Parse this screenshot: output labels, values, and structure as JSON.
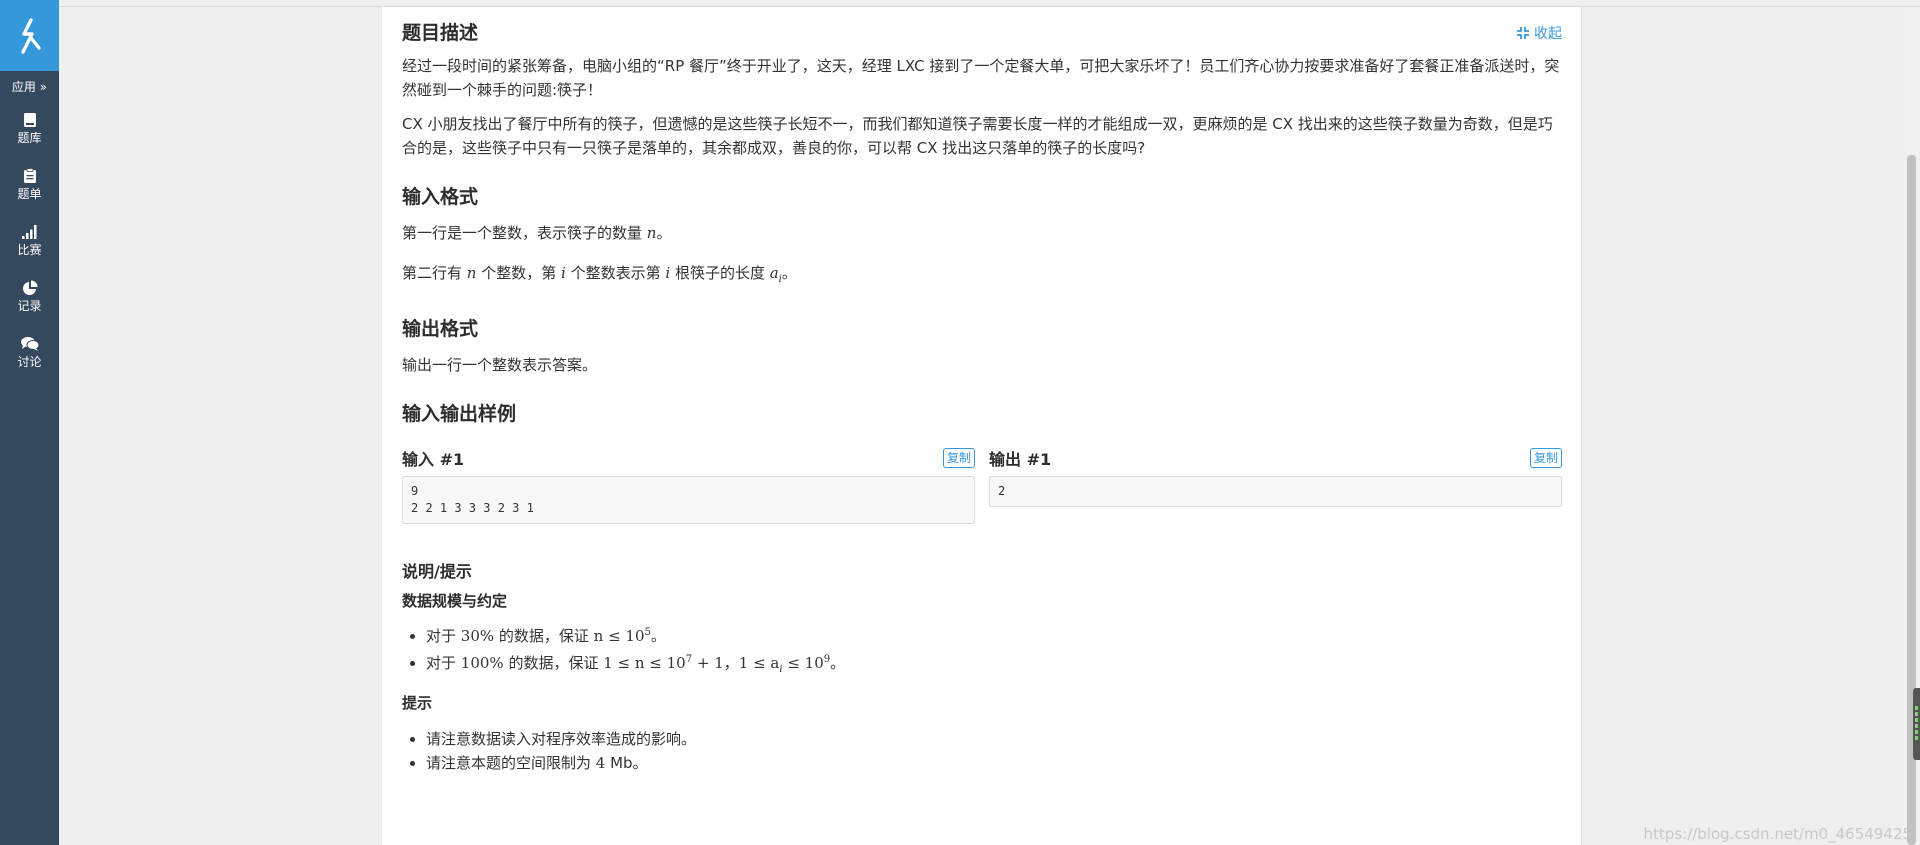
{
  "sidebar": {
    "apps_label": "应用 »",
    "items": [
      {
        "label": "题库",
        "icon": "book-icon"
      },
      {
        "label": "题单",
        "icon": "clipboard-icon"
      },
      {
        "label": "比赛",
        "icon": "signal-bars-icon"
      },
      {
        "label": "记录",
        "icon": "pie-chart-icon"
      },
      {
        "label": "讨论",
        "icon": "comments-icon"
      }
    ]
  },
  "problem": {
    "desc_title": "题目描述",
    "collapse_label": "收起",
    "desc_p1": "经过一段时间的紧张筹备，电脑小组的“RP 餐厅”终于开业了，这天，经理 LXC 接到了一个定餐大单，可把大家乐坏了！员工们齐心协力按要求准备好了套餐正准备派送时，突然碰到一个棘手的问题:筷子！",
    "desc_p2": "CX 小朋友找出了餐厅中所有的筷子，但遗憾的是这些筷子长短不一，而我们都知道筷子需要长度一样的才能组成一双，更麻烦的是 CX 找出来的这些筷子数量为奇数，但是巧合的是，这些筷子中只有一只筷子是落单的，其余都成双，善良的你，可以帮 CX 找出这只落单的筷子的长度吗?",
    "input_title": "输入格式",
    "input_l1_a": "第一行是一个整数，表示筷子的数量 ",
    "input_l1_var": "n",
    "input_l1_b": "。",
    "input_l2_a": "第二行有 ",
    "input_l2_var1": "n",
    "input_l2_b": " 个整数，第 ",
    "input_l2_var2": "i",
    "input_l2_c": " 个整数表示第 ",
    "input_l2_var3": "i",
    "input_l2_d": " 根筷子的长度 ",
    "input_l2_var4": "a",
    "input_l2_sub": "i",
    "input_l2_e": "。",
    "output_title": "输出格式",
    "output_text": "输出一行一个整数表示答案。",
    "samples_title": "输入输出样例",
    "sample_in_label": "输入 #1",
    "sample_out_label": "输出 #1",
    "copy_label": "复制",
    "sample_in": "9\n2 2 1 3 3 3 2 3 1",
    "sample_out": "2",
    "hint_title": "说明/提示",
    "scale_title": "数据规模与约定",
    "scale_1_a": "对于 ",
    "scale_1_pct": "30%",
    "scale_1_b": " 的数据，保证 ",
    "scale_1_expr": "n ≤ 10",
    "scale_1_exp": "5",
    "scale_1_c": "。",
    "scale_2_a": "对于 ",
    "scale_2_pct": "100%",
    "scale_2_b": " 的数据，保证 ",
    "scale_2_expr1": "1 ≤ n ≤ 10",
    "scale_2_exp1": "7",
    "scale_2_expr2": " + 1",
    "scale_2_c": "，",
    "scale_2_expr3": "1 ≤ a",
    "scale_2_sub": "i",
    "scale_2_expr4": " ≤ 10",
    "scale_2_exp2": "9",
    "scale_2_d": "。",
    "tip_title": "提示",
    "tip_1": "请注意数据读入对程序效率造成的影响。",
    "tip_2_a": "请注意本题的空间限制为 ",
    "tip_2_num": "4",
    "tip_2_b": " Mb。"
  },
  "watermark": "https://blog.csdn.net/m0_46549425"
}
